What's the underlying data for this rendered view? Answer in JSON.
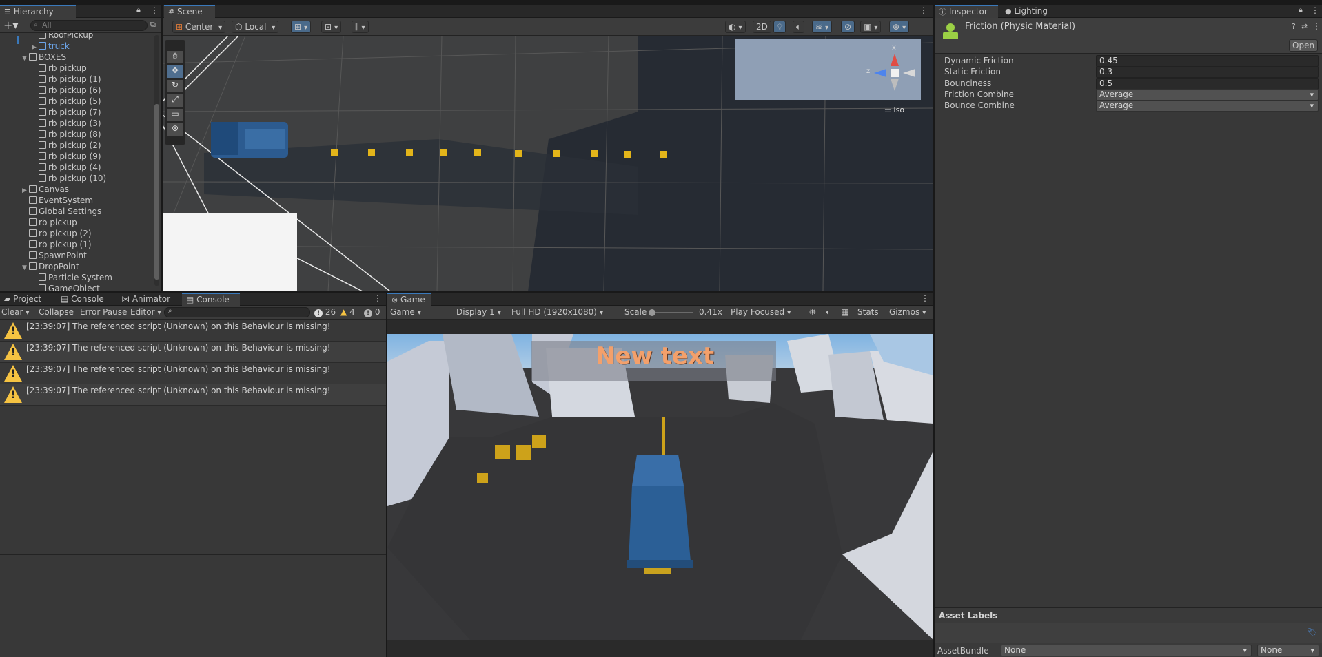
{
  "hierarchy": {
    "tab": "Hierarchy",
    "search_placeholder": "All",
    "items": [
      {
        "label": "RoofPickup",
        "indent": 2,
        "fold": ""
      },
      {
        "label": "truck",
        "indent": 2,
        "fold": "▶"
      },
      {
        "label": "BOXES",
        "indent": 1,
        "fold": "▼"
      },
      {
        "label": "rb pickup",
        "indent": 2,
        "fold": ""
      },
      {
        "label": "rb pickup (1)",
        "indent": 2,
        "fold": ""
      },
      {
        "label": "rb pickup (6)",
        "indent": 2,
        "fold": ""
      },
      {
        "label": "rb pickup (5)",
        "indent": 2,
        "fold": ""
      },
      {
        "label": "rb pickup (7)",
        "indent": 2,
        "fold": ""
      },
      {
        "label": "rb pickup (3)",
        "indent": 2,
        "fold": ""
      },
      {
        "label": "rb pickup (8)",
        "indent": 2,
        "fold": ""
      },
      {
        "label": "rb pickup (2)",
        "indent": 2,
        "fold": ""
      },
      {
        "label": "rb pickup (9)",
        "indent": 2,
        "fold": ""
      },
      {
        "label": "rb pickup (4)",
        "indent": 2,
        "fold": ""
      },
      {
        "label": "rb pickup (10)",
        "indent": 2,
        "fold": ""
      },
      {
        "label": "Canvas",
        "indent": 1,
        "fold": "▶"
      },
      {
        "label": "EventSystem",
        "indent": 1,
        "fold": ""
      },
      {
        "label": "Global Settings",
        "indent": 1,
        "fold": ""
      },
      {
        "label": "rb pickup",
        "indent": 1,
        "fold": ""
      },
      {
        "label": "rb pickup (2)",
        "indent": 1,
        "fold": ""
      },
      {
        "label": "rb pickup (1)",
        "indent": 1,
        "fold": ""
      },
      {
        "label": "SpawnPoint",
        "indent": 1,
        "fold": ""
      },
      {
        "label": "DropPoint",
        "indent": 1,
        "fold": "▼"
      },
      {
        "label": "Particle System",
        "indent": 2,
        "fold": ""
      },
      {
        "label": "GameObject",
        "indent": 2,
        "fold": ""
      }
    ]
  },
  "scene": {
    "tab": "Scene",
    "pivot": "Center",
    "space": "Local",
    "mode_2d": "2D",
    "iso_label": "Iso",
    "axis_x": "x",
    "axis_z": "z"
  },
  "inspector": {
    "tab": "Inspector",
    "tab2": "Lighting",
    "title": "Friction (Physic Material)",
    "open_button": "Open",
    "properties": [
      {
        "label": "Dynamic Friction",
        "value": "0.45",
        "kind": "text"
      },
      {
        "label": "Static Friction",
        "value": "0.3",
        "kind": "text"
      },
      {
        "label": "Bounciness",
        "value": "0.5",
        "kind": "text"
      },
      {
        "label": "Friction Combine",
        "value": "Average",
        "kind": "dropdown"
      },
      {
        "label": "Bounce Combine",
        "value": "Average",
        "kind": "dropdown"
      }
    ],
    "asset_labels": "Asset Labels",
    "asset_bundle_label": "AssetBundle",
    "asset_bundle_value": "None",
    "asset_variant_value": "None"
  },
  "console": {
    "tabs": [
      "Project",
      "Console",
      "Animator",
      "Console"
    ],
    "clear": "Clear",
    "collapse": "Collapse",
    "error_pause": "Error Pause",
    "editor": "Editor",
    "count_log": "26",
    "count_warn": "4",
    "count_error": "0",
    "messages": [
      "[23:39:07] The referenced script (Unknown) on this Behaviour is missing!",
      "[23:39:07] The referenced script (Unknown) on this Behaviour is missing!",
      "[23:39:07] The referenced script (Unknown) on this Behaviour is missing!",
      "[23:39:07] The referenced script (Unknown) on this Behaviour is missing!"
    ]
  },
  "game": {
    "tab": "Game",
    "view": "Game",
    "display": "Display 1",
    "resolution": "Full HD (1920x1080)",
    "scale_label": "Scale",
    "scale_value": "0.41x",
    "play_mode": "Play Focused",
    "stats": "Stats",
    "gizmos": "Gizmos",
    "overlay_text": "New text"
  }
}
